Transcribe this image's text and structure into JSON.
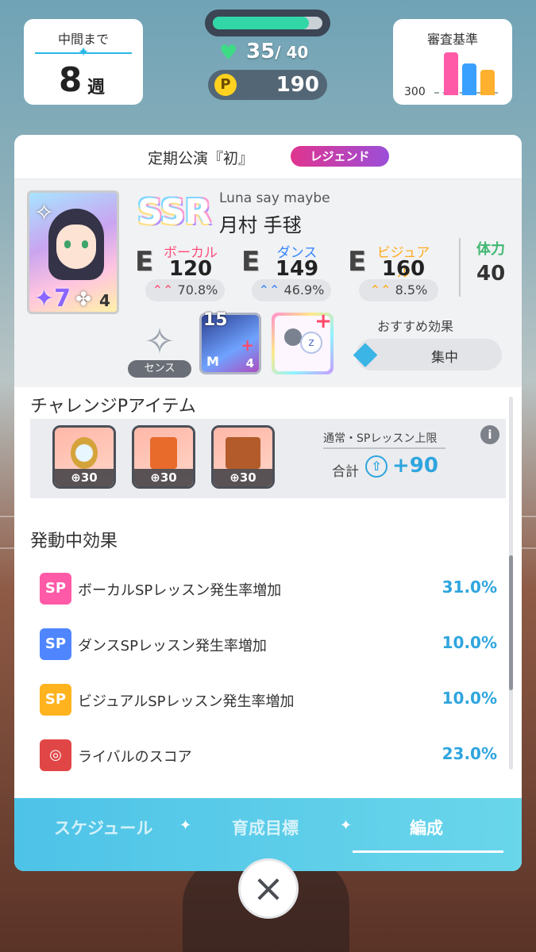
{
  "hud": {
    "week_label": "中間まで",
    "week_num": "8",
    "week_unit": "週",
    "hp_current": "35",
    "hp_max": "/ 40",
    "hp_ratio": 0.875,
    "p_icon": "P",
    "p_value": "190",
    "criteria_label": "審査基準",
    "criteria_tick": "300",
    "criteria_colors": [
      "#ff5aa7",
      "#3aa0ff",
      "#ffb02e"
    ]
  },
  "panel": {
    "title": "定期公演『初』",
    "tag": "レジェンド",
    "idol": {
      "rarity": "SSR",
      "subtitle": "Luna say maybe",
      "name": "月村 手毬",
      "card_level": "7",
      "card_clover": "4",
      "stats": [
        {
          "rank": "E",
          "name": "ボーカル",
          "value": "120",
          "pct": "70.8%",
          "color": "#ff4f7b"
        },
        {
          "rank": "E",
          "name": "ダンス",
          "value": "149",
          "pct": "46.9%",
          "color": "#3a86ff"
        },
        {
          "rank": "E",
          "name": "ビジュアル",
          "value": "160",
          "pct": "8.5%",
          "color": "#ffab1f"
        }
      ],
      "stamina_label": "体力",
      "stamina_value": "40",
      "sense_label": "センス",
      "item_a_level": "15",
      "item_a_m": "M",
      "item_a_n": "4",
      "recommend_label": "おすすめ効果",
      "recommend_value": "集中"
    },
    "challenge": {
      "title": "チャレンジPアイテム",
      "items": [
        {
          "name": "mirror",
          "value": "30"
        },
        {
          "name": "book",
          "value": "30"
        },
        {
          "name": "case",
          "value": "30"
        }
      ],
      "limit_label": "通常・SPレッスン上限",
      "total_label": "合計",
      "total_value": "+90",
      "info_icon": "i"
    },
    "effects": {
      "title": "発動中効果",
      "rows": [
        {
          "icon": "SP",
          "label": "ボーカルSPレッスン発生率増加",
          "value": "31.0%",
          "color": "#ff5aa7"
        },
        {
          "icon": "SP",
          "label": "ダンスSPレッスン発生率増加",
          "value": "10.0%",
          "color": "#4f86ff"
        },
        {
          "icon": "SP",
          "label": "ビジュアルSPレッスン発生率増加",
          "value": "10.0%",
          "color": "#ffb31f"
        },
        {
          "icon": "target",
          "label": "ライバルのスコア",
          "value": "23.0%",
          "color": "#e14646"
        }
      ]
    },
    "tabs": [
      {
        "label": "スケジュール",
        "active": false
      },
      {
        "label": "育成目標",
        "active": false
      },
      {
        "label": "編成",
        "active": true
      }
    ]
  },
  "close_label": "×"
}
